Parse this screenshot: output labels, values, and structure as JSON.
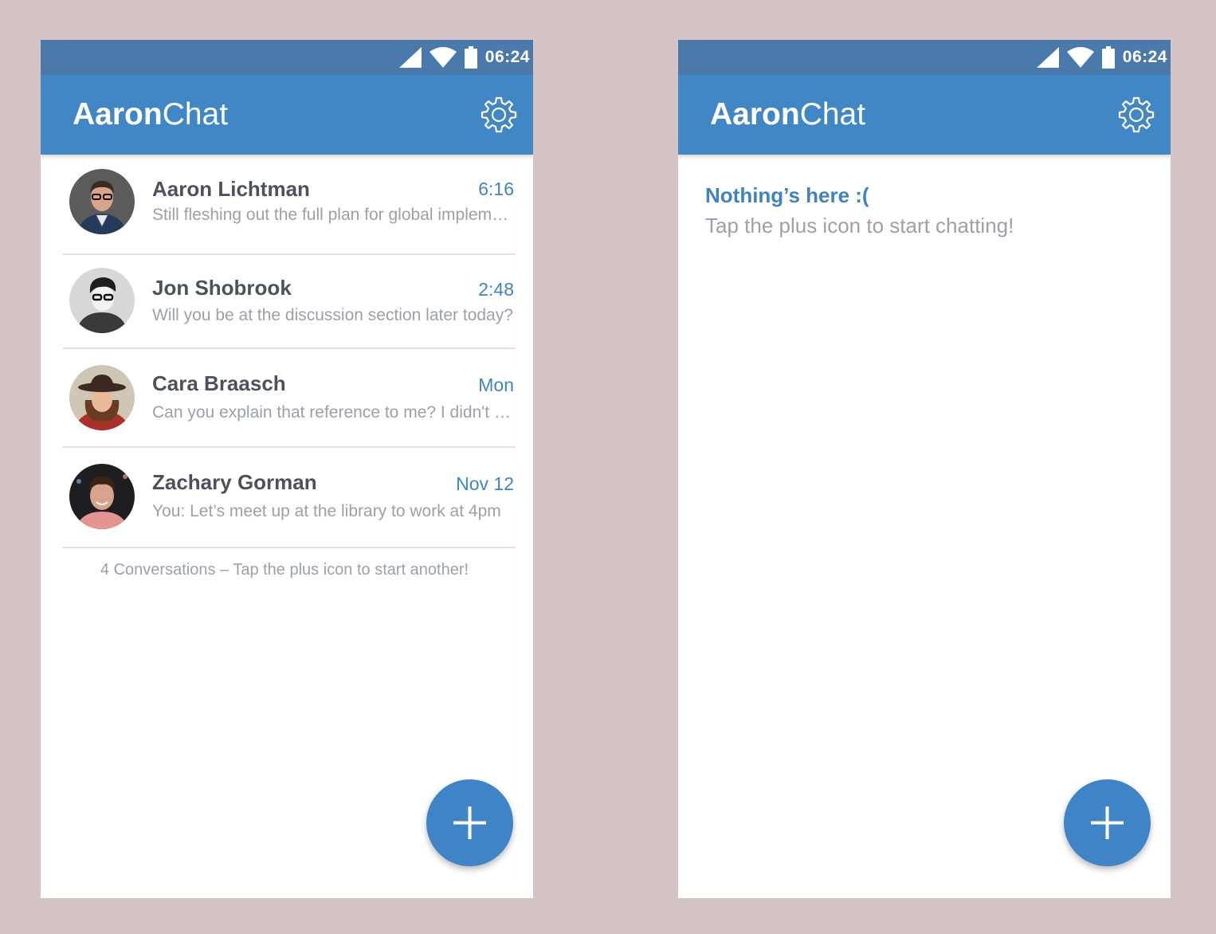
{
  "status_bar": {
    "time": "06:24"
  },
  "app": {
    "title_bold": "Aaron",
    "title_light": "Chat"
  },
  "conversations": [
    {
      "name": "Aaron Lichtman",
      "time": "6:16",
      "preview": "Still fleshing out the full plan for global implementation"
    },
    {
      "name": "Jon Shobrook",
      "time": "2:48",
      "preview": "Will you be at the discussion section later today?"
    },
    {
      "name": "Cara Braasch",
      "time": "Mon",
      "preview": "Can you explain that reference to me? I didn't get it"
    },
    {
      "name": "Zachary Gorman",
      "time": "Nov 12",
      "preview": "You: Let’s meet up at the library to work at 4pm"
    }
  ],
  "list_footer": "4 Conversations – Tap the plus icon to start another!",
  "empty_state": {
    "title": "Nothing’s here :(",
    "subtitle": "Tap the plus icon to start chatting!"
  },
  "colors": {
    "status_bar": "#4a7aac",
    "app_bar": "#4187c6",
    "accent": "#3f84c2",
    "background": "#d4c4c5"
  },
  "icons": [
    "signal-icon",
    "wifi-icon",
    "battery-icon",
    "gear-icon",
    "plus-icon"
  ]
}
